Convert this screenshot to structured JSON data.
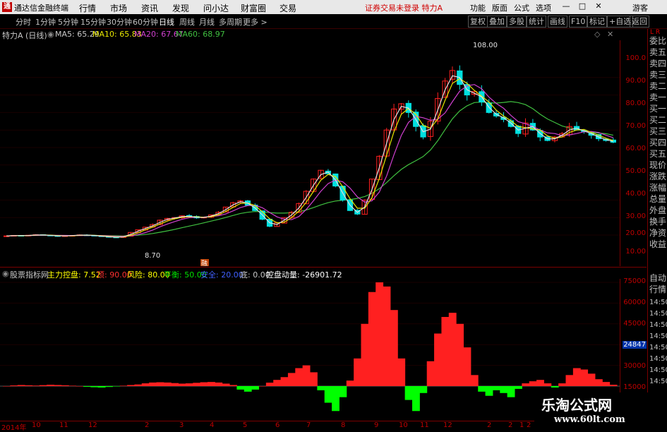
{
  "app": {
    "name": "通达信金融终端",
    "logo": "通"
  },
  "menu": [
    "行情",
    "市场",
    "资讯",
    "发现",
    "问小达",
    "财富圈",
    "交易"
  ],
  "notice": "证券交易未登录  特力A",
  "right_menu": [
    "功能",
    "版面",
    "公式",
    "选项"
  ],
  "guest": "游客",
  "window_buttons": [
    "—",
    "□",
    "✕"
  ],
  "periods": [
    "分时",
    "1分钟",
    "5分钟",
    "15分钟",
    "30分钟",
    "60分钟",
    "日线",
    "周线",
    "月线",
    "多周期",
    "更多 >"
  ],
  "active_period": "日线",
  "tools": [
    "复权",
    "叠加",
    "多股",
    "统计",
    "画线",
    "F10",
    "标记",
    "+自选",
    "返回"
  ],
  "stock_title": "特力A (日线)",
  "ma": [
    {
      "label": "MA5: 65.29",
      "color": "#e0e0e0"
    },
    {
      "label": "MA10: 65.83",
      "color": "#e8e800"
    },
    {
      "label": "MA20: 67.67",
      "color": "#d040d0"
    },
    {
      "label": "MA60: 68.97",
      "color": "#40c040"
    }
  ],
  "price_ticks": [
    "100.0",
    "90.00",
    "80.00",
    "70.00",
    "60.00",
    "50.00",
    "40.00",
    "30.00",
    "20.00",
    "10.00"
  ],
  "annotations": {
    "high": "108.00",
    "low": "8.70",
    "event": "融"
  },
  "right_tabs": [
    "委比",
    "卖五",
    "卖四",
    "卖三",
    "卖二",
    "卖一",
    "买一",
    "买二",
    "买三",
    "买四",
    "买五",
    "现价",
    "涨跌",
    "涨幅",
    "总量",
    "外盘",
    "换手",
    "净资",
    "收益",
    "自动",
    "行情",
    "14:50",
    "14:50",
    "14:50",
    "14:50",
    "14:50",
    "14:50",
    "14:50",
    "14:50"
  ],
  "right_corner": "L R",
  "indicator": {
    "name": "股票指标网",
    "items": [
      {
        "label": "主力控盘: 7.52",
        "color": "#ffff00"
      },
      {
        "label": "顶: 90.00",
        "color": "#ff3030"
      },
      {
        "label": "风险: 80.00",
        "color": "#ffff00"
      },
      {
        "label": "平衡: 50.00",
        "color": "#00e000"
      },
      {
        "label": "安全: 20.00",
        "color": "#4060ff"
      },
      {
        "label": "底: 0.00",
        "color": "#c8c8c8"
      },
      {
        "label": "控盘动量: -26901.72",
        "color": "#ffffff"
      }
    ]
  },
  "sub_ticks": [
    "75000",
    "60000",
    "45000",
    "30000",
    "15000"
  ],
  "sub_current": "24847",
  "date_ticks": [
    "2014年",
    "10",
    "11",
    "12",
    "2",
    "3",
    "4",
    "5",
    "6",
    "7",
    "8",
    "9",
    "10",
    "11",
    "12",
    "2",
    "2",
    "1",
    "2"
  ],
  "watermark": {
    "title": "乐淘公式网",
    "url": "www.60lt.com"
  },
  "colors": {
    "up": "#ff2020",
    "down": "#00ff00",
    "axis": "#c00000",
    "border": "#7a0000"
  },
  "chart_data": {
    "type": "candlestick",
    "price_series": [
      9.5,
      9.8,
      9.6,
      9.9,
      10.2,
      10.0,
      9.7,
      9.4,
      9.6,
      9.8,
      10.1,
      9.9,
      9.6,
      9.2,
      8.9,
      8.7,
      9.3,
      11.5,
      13.0,
      14.5,
      16.0,
      18.5,
      19.5,
      20.0,
      21.0,
      20.5,
      19.8,
      20.2,
      21.5,
      23.0,
      26.0,
      28.5,
      29.5,
      27.0,
      24.0,
      19.0,
      15.0,
      17.0,
      20.0,
      23.0,
      28.0,
      35.0,
      42.0,
      47.0,
      45.0,
      38.0,
      30.0,
      24.0,
      22.0,
      30.0,
      42.0,
      55.0,
      70.0,
      82.0,
      85.0,
      80.0,
      72.0,
      66.0,
      75.0,
      88.0,
      98.0,
      104.0,
      96.0,
      90.0,
      92.0,
      86.0,
      80.0,
      78.0,
      76.0,
      72.0,
      68.0,
      74.0,
      70.0,
      66.0,
      64.0,
      66.0,
      68.0,
      72.0,
      70.0,
      69.0,
      67.0,
      65.0,
      64.0,
      63.0
    ],
    "momentum_series": [
      0,
      500,
      800,
      600,
      400,
      700,
      1000,
      800,
      600,
      300,
      0,
      -500,
      -800,
      -1000,
      -600,
      -200,
      300,
      800,
      1200,
      2000,
      2600,
      2800,
      2600,
      2200,
      1800,
      2000,
      2400,
      2800,
      3000,
      2600,
      1800,
      800,
      -2500,
      -4000,
      -2500,
      0,
      2500,
      4500,
      6500,
      9500,
      13000,
      15000,
      10000,
      -3000,
      -12000,
      -18000,
      -8000,
      4000,
      20000,
      45000,
      68000,
      75000,
      72000,
      55000,
      20000,
      -10000,
      -18000,
      -5000,
      18000,
      38000,
      50000,
      53000,
      45000,
      28000,
      8000,
      -4000,
      -7000,
      -3000,
      -5000,
      -8000,
      -2000,
      2000,
      3500,
      4500,
      2000,
      -1000,
      2000,
      8000,
      13000,
      12000,
      9000,
      5000,
      3000,
      1000
    ]
  }
}
